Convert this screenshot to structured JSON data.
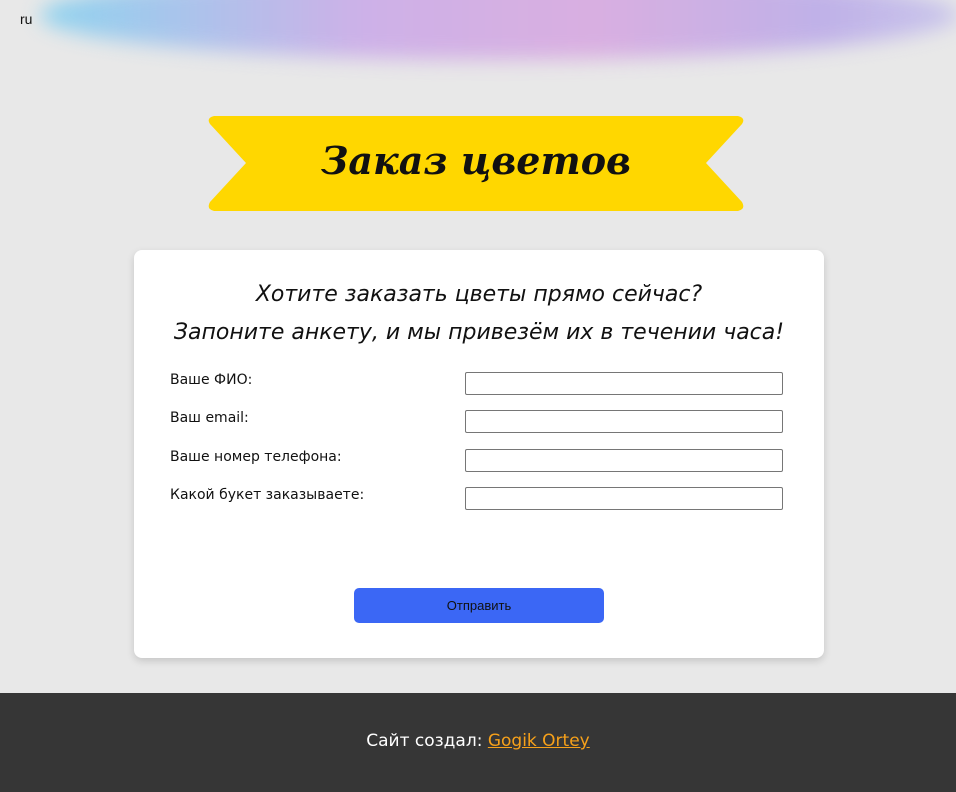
{
  "header": {
    "lang": "ru",
    "title": "Заказ цветов"
  },
  "form": {
    "lead_line1": "Хотите заказать цветы прямо сейчас?",
    "lead_line2": "Запоните анкету, и мы привезём их в течении часа!",
    "fields": [
      {
        "label": "Ваше ФИО:",
        "value": ""
      },
      {
        "label": "Ваш email:",
        "value": ""
      },
      {
        "label": "Ваше номер телефона:",
        "value": ""
      },
      {
        "label": "Какой букет заказываете:",
        "value": ""
      }
    ],
    "submit_label": "Отправить"
  },
  "footer": {
    "prefix": "Сайт создал:",
    "author": "Gogik Ortey"
  },
  "colors": {
    "background": "#e8e8e8",
    "banner": "#ffd700",
    "submit_button": "#3b67f5",
    "footer": "#363636",
    "footer_link": "#f7a11a"
  }
}
